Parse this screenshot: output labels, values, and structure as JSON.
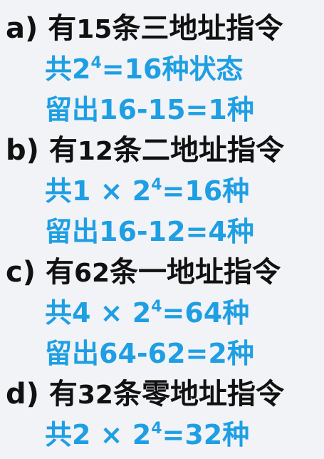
{
  "items": [
    {
      "heading": {
        "marker": "a)",
        "pre": "有",
        "count": "15",
        "post": "条三地址指令"
      },
      "lines": [
        {
          "prefix": "共",
          "expr_a": "2",
          "exp": "4",
          "expr_b": "=16种状态"
        },
        {
          "text": "留出16-15=1种"
        }
      ]
    },
    {
      "heading": {
        "marker": "b)",
        "pre": "有",
        "count": "12",
        "post": "条二地址指令"
      },
      "lines": [
        {
          "prefix": "共",
          "expr_a": "1 × 2",
          "exp": "4",
          "expr_b": "=16种"
        },
        {
          "text": "留出16-12=4种"
        }
      ]
    },
    {
      "heading": {
        "marker": "c)",
        "pre": "有",
        "count": "62",
        "post": "条一地址指令"
      },
      "lines": [
        {
          "prefix": "共",
          "expr_a": "4 × 2",
          "exp": "4",
          "expr_b": "=64种"
        },
        {
          "text": "留出64-62=2种"
        }
      ]
    },
    {
      "heading": {
        "marker": "d)",
        "pre": "有",
        "count": "32",
        "post": "条零地址指令"
      },
      "lines": [
        {
          "prefix": "共",
          "expr_a": "2 × 2",
          "exp": "4",
          "expr_b": "=32种"
        }
      ]
    }
  ],
  "colors": {
    "heading": "#111111",
    "answer": "#1e9fe3",
    "background": "#f2f3f7"
  }
}
